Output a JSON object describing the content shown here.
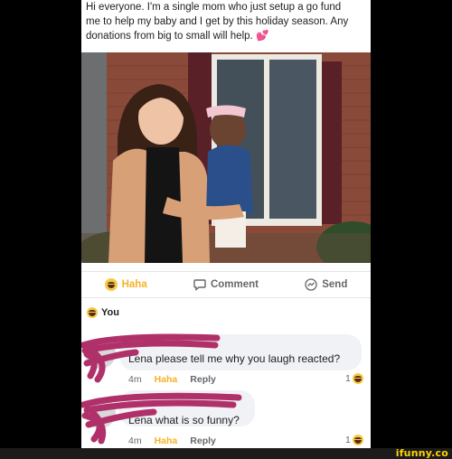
{
  "post": {
    "text_line1": "Hi everyone. I'm a single mom who just setup a go fund",
    "text_line2": "me to help my baby and I get by this holiday season. Any",
    "text_line3": "donations from big to small will help.",
    "heart_emoji": "💕"
  },
  "actions": {
    "haha_label": "Haha",
    "comment_label": "Comment",
    "send_label": "Send"
  },
  "reaction_summary": {
    "label": "You"
  },
  "comments": [
    {
      "text": "Lena please tell me why you laugh reacted?",
      "time": "4m",
      "haha": "Haha",
      "reply": "Reply",
      "count": "1"
    },
    {
      "text": "Lena what is so funny?",
      "time": "4m",
      "haha": "Haha",
      "reply": "Reply",
      "count": "1"
    }
  ],
  "watermark": "ifunny.co",
  "colors": {
    "haha": "#f7b125",
    "scribble": "#b0306a",
    "bubble": "#f0f2f5"
  }
}
